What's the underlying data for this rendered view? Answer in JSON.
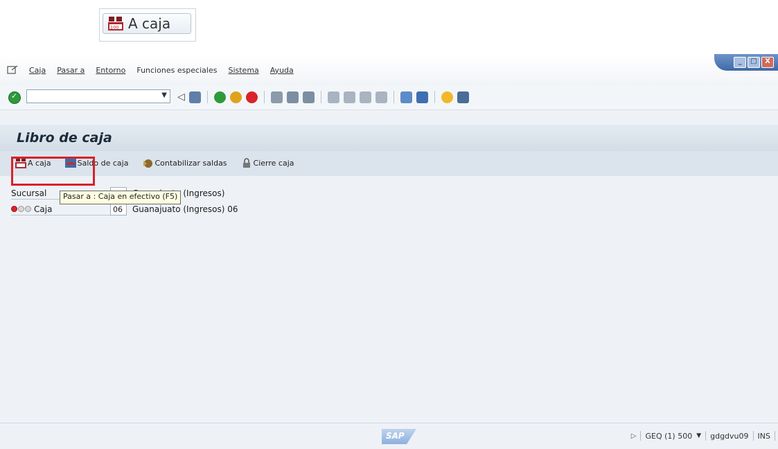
{
  "zoom_callout": {
    "label": "A caja"
  },
  "menu": {
    "items": [
      "Caja",
      "Pasar a",
      "Entorno",
      "Funciones especiales",
      "Sistema",
      "Ayuda"
    ]
  },
  "window_controls": [
    "_",
    "□",
    "X"
  ],
  "toolbar": {
    "command_field_value": ""
  },
  "title": "Libro de caja",
  "app_toolbar": {
    "a_caja": "A caja",
    "saldo_de_caja": "Saldo de caja",
    "contabilizar_salidas": "Contabilizar saldas",
    "cierre_caja": "Cierre caja"
  },
  "tooltip": "Pasar a : Caja en efectivo   (F5)",
  "fields": {
    "sucursal_label": "Sucursal",
    "sucursal_desc": "Guanajuato (Ingresos)",
    "caja_label": "Caja",
    "caja_value": "06",
    "caja_desc": "Guanajuato (Ingresos) 06"
  },
  "status_bar": {
    "logo": "SAP",
    "system": "GEQ (1) 500",
    "user": "gdgdvu09",
    "mode": "INS"
  }
}
